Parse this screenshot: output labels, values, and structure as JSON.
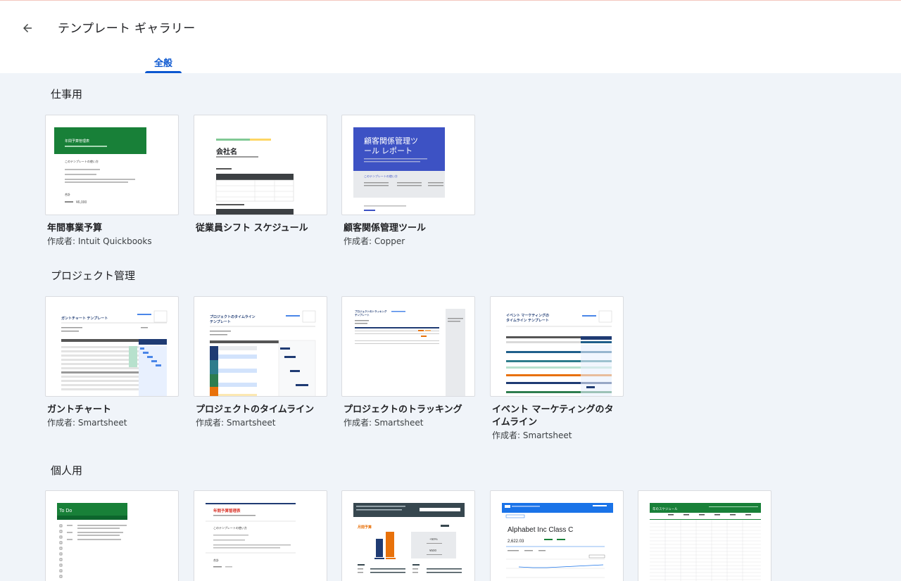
{
  "header": {
    "title": "テンプレート ギャラリー",
    "back_icon": "arrow-left-icon",
    "tabs": [
      {
        "label": "全般",
        "active": true
      }
    ]
  },
  "colors": {
    "accent": "#0b57d0",
    "background": "#f0f4f9"
  },
  "sections": [
    {
      "title": "仕事用",
      "cards": [
        {
          "title": "年間事業予算",
          "author": "作成者: Intuit Quickbooks",
          "thumb": {
            "heading": "年間予算管理表",
            "subheading": "このテンプレートの使い方",
            "label": "合計",
            "value": "¥6,000"
          }
        },
        {
          "title": "従業員シフト スケジュール",
          "author": "",
          "thumb": {
            "heading": "会社名"
          }
        },
        {
          "title": "顧客関係管理ツール",
          "author": "作成者: Copper",
          "thumb": {
            "heading": "顧客関係管理ツ\nール レポート",
            "line1": "顧客関係管理ツ",
            "line2": "ール レポート",
            "subheading": "このテンプレートの使い方"
          }
        }
      ]
    },
    {
      "title": "プロジェクト管理",
      "cards": [
        {
          "title": "ガントチャート",
          "author": "作成者: Smartsheet",
          "thumb": {
            "heading": "ガントチャート テンプレート"
          }
        },
        {
          "title": "プロジェクトのタイムライン",
          "author": "作成者: Smartsheet",
          "thumb": {
            "line1": "プロジェクトのタイムライン",
            "line2": "テンプレート"
          }
        },
        {
          "title": "プロジェクトのトラッキング",
          "author": "作成者: Smartsheet",
          "thumb": {
            "line1": "プロジェクトのトラッキング",
            "line2": "テンプレート"
          }
        },
        {
          "title": "イベント マーケティングのタイムライン",
          "author": "作成者: Smartsheet",
          "title_line1": "イベント マーケティングのタ",
          "title_line2": "イムライン",
          "thumb": {
            "line1": "イベント マーケティングの",
            "line2": "タイムライン テンプレート"
          }
        }
      ]
    },
    {
      "title": "個人用",
      "cards": [
        {
          "title": "",
          "author": "",
          "thumb": {
            "heading": "To Do"
          }
        },
        {
          "title": "",
          "author": "",
          "thumb": {
            "heading": "年間予算管理表",
            "subheading": "このテンプレートの使い方",
            "label": "合計"
          }
        },
        {
          "title": "",
          "author": "",
          "thumb": {
            "heading": "月間予算",
            "stat1": "+50%",
            "stat2": "¥500"
          }
        },
        {
          "title": "",
          "author": "",
          "thumb": {
            "heading": "Alphabet Inc Class C",
            "value": "2,622.03"
          }
        },
        {
          "title": "",
          "author": "",
          "thumb": {
            "heading": "年のスケジュール"
          }
        }
      ]
    }
  ]
}
